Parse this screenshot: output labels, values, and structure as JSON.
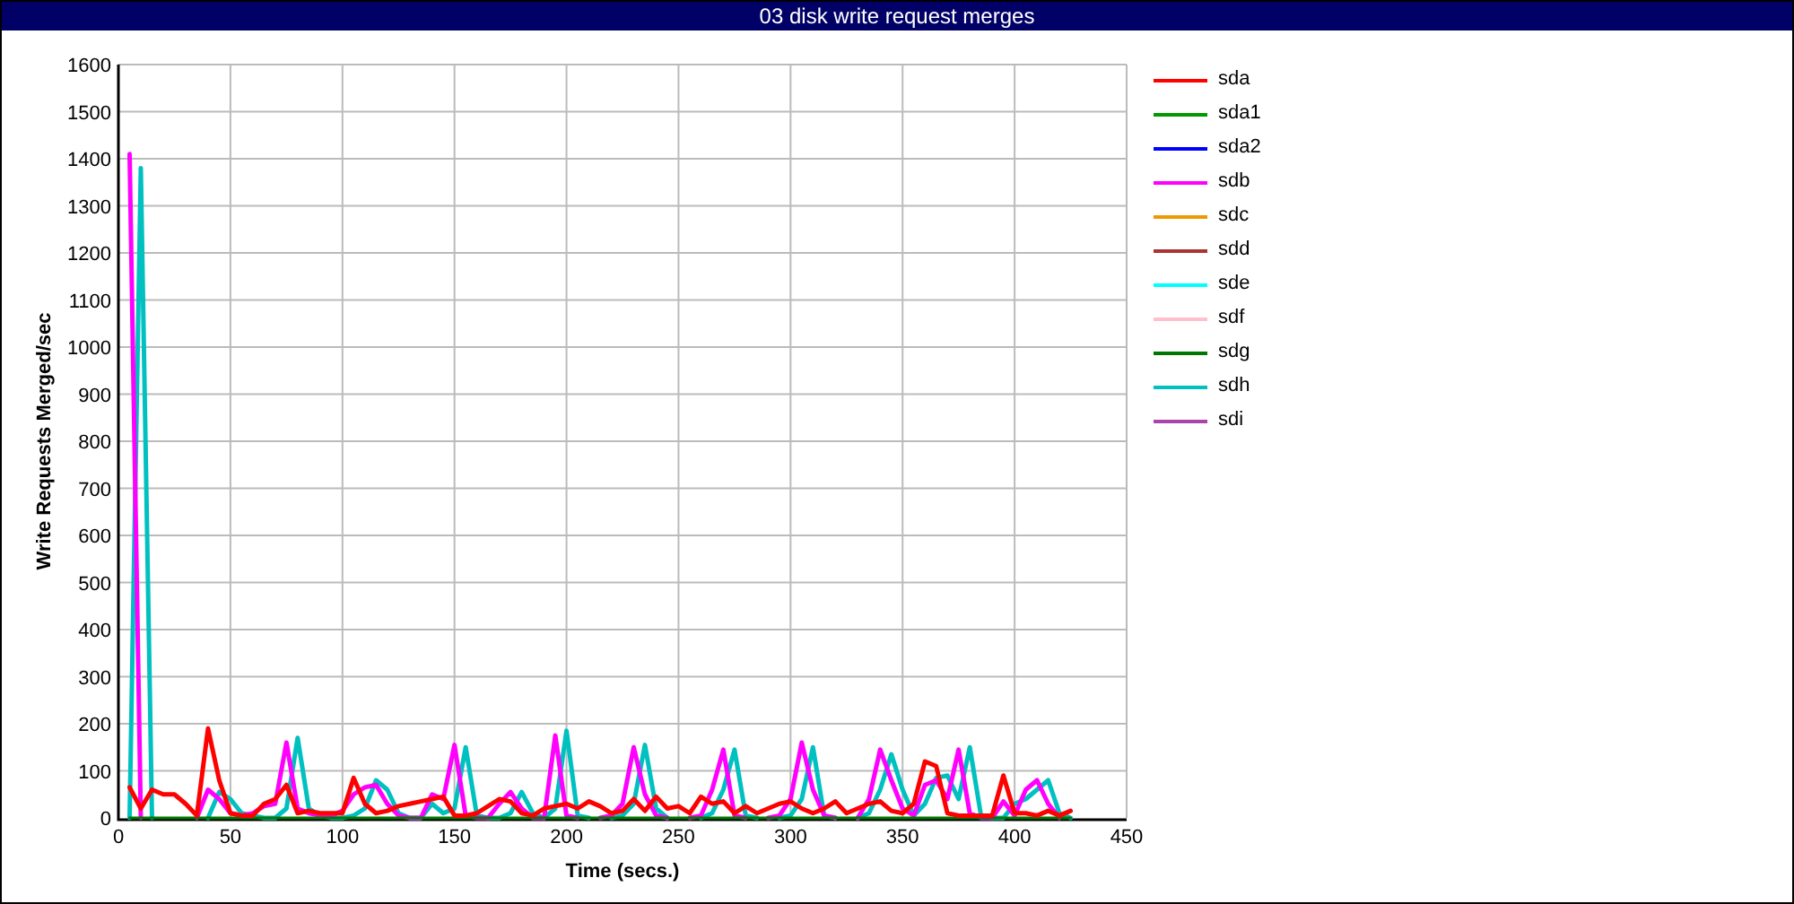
{
  "window": {
    "title": "03 disk write request merges"
  },
  "chart": {
    "chart_data": {
      "type": "line",
      "xlabel": "Time (secs.)",
      "ylabel": "Write Requests Merged/sec",
      "grid": true,
      "xlim": [
        0,
        450
      ],
      "ylim": [
        0,
        1600
      ],
      "xticks": [
        0,
        50,
        100,
        150,
        200,
        250,
        300,
        350,
        400,
        450
      ],
      "yticks": [
        0,
        100,
        200,
        300,
        400,
        500,
        600,
        700,
        800,
        900,
        1000,
        1100,
        1200,
        1300,
        1400,
        1500,
        1600
      ],
      "x": [
        5,
        10,
        15,
        20,
        25,
        30,
        35,
        40,
        45,
        50,
        55,
        60,
        65,
        70,
        75,
        80,
        85,
        90,
        95,
        100,
        105,
        110,
        115,
        120,
        125,
        130,
        135,
        140,
        145,
        150,
        155,
        160,
        165,
        170,
        175,
        180,
        185,
        190,
        195,
        200,
        205,
        210,
        215,
        220,
        225,
        230,
        235,
        240,
        245,
        250,
        255,
        260,
        265,
        270,
        275,
        280,
        285,
        290,
        295,
        300,
        305,
        310,
        315,
        320,
        325,
        330,
        335,
        340,
        345,
        350,
        355,
        360,
        365,
        370,
        375,
        380,
        385,
        390,
        395,
        400,
        405,
        410,
        415,
        420,
        425
      ],
      "series": [
        {
          "name": "sda",
          "color": "#ff0000",
          "values": [
            65,
            20,
            60,
            50,
            50,
            30,
            5,
            190,
            80,
            10,
            5,
            5,
            30,
            40,
            70,
            10,
            15,
            10,
            10,
            10,
            85,
            30,
            10,
            15,
            25,
            30,
            35,
            40,
            45,
            5,
            5,
            10,
            25,
            40,
            35,
            10,
            5,
            20,
            25,
            30,
            20,
            35,
            25,
            10,
            15,
            40,
            15,
            45,
            20,
            25,
            10,
            45,
            30,
            35,
            10,
            25,
            10,
            20,
            30,
            35,
            20,
            10,
            20,
            35,
            10,
            20,
            30,
            35,
            15,
            10,
            30,
            120,
            110,
            10,
            5,
            5,
            5,
            5,
            90,
            10,
            10,
            5,
            15,
            5,
            15
          ]
        },
        {
          "name": "sda1",
          "color": "#009900",
          "values": [
            null,
            null,
            null,
            null,
            null,
            null,
            null,
            null,
            null,
            null,
            null,
            null,
            null,
            null,
            null,
            null,
            null,
            null,
            null,
            null,
            null,
            null,
            null,
            null,
            null,
            null,
            null,
            null,
            null,
            null,
            null,
            null,
            null,
            null,
            null,
            null,
            null,
            null,
            null,
            null,
            null,
            null,
            null,
            null,
            null,
            null,
            null,
            null,
            null,
            null,
            null,
            null,
            null,
            null,
            null,
            null,
            null,
            null,
            null,
            null,
            null,
            null,
            null,
            null,
            null,
            null,
            null,
            null,
            null,
            null,
            null,
            null,
            null,
            null,
            null,
            null,
            null,
            null,
            null,
            null,
            null,
            null,
            null,
            null,
            null
          ]
        },
        {
          "name": "sda2",
          "color": "#0000ff",
          "values": [
            null,
            null,
            null,
            null,
            null,
            null,
            null,
            null,
            null,
            null,
            null,
            null,
            null,
            null,
            null,
            null,
            null,
            null,
            null,
            null,
            null,
            null,
            null,
            null,
            null,
            null,
            null,
            null,
            null,
            null,
            null,
            null,
            null,
            null,
            null,
            null,
            null,
            null,
            null,
            null,
            null,
            null,
            null,
            null,
            null,
            null,
            null,
            null,
            null,
            null,
            null,
            null,
            null,
            null,
            null,
            null,
            null,
            null,
            null,
            null,
            null,
            null,
            null,
            null,
            null,
            null,
            null,
            null,
            null,
            null,
            null,
            null,
            null,
            null,
            null,
            null,
            null,
            null,
            null,
            null,
            null,
            null,
            null,
            null,
            null
          ]
        },
        {
          "name": "sdb",
          "color": "#ff00ff",
          "values": [
            1410,
            0,
            null,
            null,
            null,
            null,
            0,
            60,
            40,
            10,
            5,
            10,
            25,
            30,
            160,
            20,
            10,
            5,
            5,
            15,
            50,
            65,
            70,
            30,
            5,
            0,
            0,
            50,
            40,
            155,
            5,
            0,
            0,
            30,
            55,
            20,
            0,
            0,
            175,
            5,
            0,
            null,
            0,
            5,
            30,
            150,
            50,
            5,
            0,
            null,
            0,
            5,
            60,
            145,
            5,
            0,
            null,
            0,
            5,
            40,
            160,
            60,
            5,
            0,
            null,
            0,
            40,
            145,
            80,
            20,
            5,
            70,
            80,
            40,
            145,
            10,
            0,
            0,
            35,
            5,
            60,
            80,
            30,
            0,
            null
          ]
        },
        {
          "name": "sdc",
          "color": "#ee9900",
          "values": [
            null,
            null,
            null,
            null,
            null,
            null,
            null,
            null,
            null,
            null,
            null,
            null,
            null,
            null,
            null,
            null,
            null,
            null,
            null,
            null,
            null,
            null,
            null,
            null,
            null,
            null,
            null,
            null,
            null,
            null,
            null,
            null,
            null,
            null,
            null,
            null,
            null,
            null,
            null,
            null,
            null,
            null,
            null,
            null,
            null,
            null,
            null,
            null,
            null,
            null,
            null,
            null,
            null,
            null,
            null,
            null,
            null,
            null,
            null,
            null,
            null,
            null,
            null,
            null,
            null,
            null,
            null,
            null,
            null,
            null,
            null,
            null,
            null,
            null,
            null,
            null,
            null,
            null,
            null,
            null,
            null,
            null,
            null,
            null,
            null
          ]
        },
        {
          "name": "sdd",
          "color": "#aa3333",
          "values": [
            null,
            null,
            null,
            null,
            null,
            null,
            null,
            null,
            null,
            null,
            null,
            null,
            null,
            null,
            null,
            null,
            null,
            null,
            null,
            null,
            null,
            null,
            null,
            null,
            null,
            null,
            null,
            null,
            null,
            null,
            null,
            null,
            null,
            null,
            null,
            null,
            null,
            null,
            null,
            null,
            null,
            null,
            null,
            null,
            null,
            null,
            null,
            null,
            null,
            null,
            null,
            null,
            null,
            null,
            null,
            null,
            null,
            null,
            null,
            null,
            null,
            null,
            null,
            null,
            null,
            null,
            null,
            null,
            null,
            null,
            null,
            null,
            null,
            null,
            null,
            null,
            null,
            null,
            null,
            null,
            null,
            null,
            null,
            null,
            null
          ]
        },
        {
          "name": "sde",
          "color": "#00ffff",
          "values": [
            null,
            null,
            null,
            null,
            null,
            null,
            null,
            null,
            null,
            null,
            null,
            null,
            null,
            null,
            null,
            null,
            null,
            null,
            null,
            null,
            null,
            null,
            null,
            null,
            null,
            null,
            null,
            null,
            null,
            null,
            null,
            null,
            null,
            null,
            null,
            null,
            null,
            null,
            null,
            null,
            null,
            null,
            null,
            null,
            null,
            null,
            null,
            null,
            null,
            null,
            null,
            null,
            null,
            null,
            null,
            null,
            null,
            null,
            null,
            null,
            null,
            null,
            null,
            null,
            null,
            null,
            null,
            null,
            null,
            null,
            null,
            null,
            null,
            null,
            null,
            null,
            null,
            null,
            null,
            null,
            null,
            null,
            null,
            null,
            null
          ]
        },
        {
          "name": "sdf",
          "color": "#ffc0cb",
          "values": [
            null,
            null,
            null,
            null,
            null,
            null,
            null,
            null,
            null,
            null,
            null,
            null,
            null,
            null,
            null,
            null,
            null,
            null,
            null,
            null,
            null,
            null,
            null,
            null,
            null,
            null,
            null,
            null,
            null,
            null,
            null,
            null,
            null,
            null,
            null,
            null,
            null,
            null,
            null,
            null,
            null,
            null,
            null,
            null,
            null,
            null,
            null,
            null,
            null,
            null,
            null,
            null,
            null,
            null,
            null,
            null,
            null,
            null,
            null,
            null,
            null,
            null,
            null,
            null,
            null,
            null,
            null,
            null,
            null,
            null,
            null,
            null,
            null,
            null,
            null,
            null,
            null,
            null,
            null,
            null,
            null,
            null,
            null,
            null,
            null
          ]
        },
        {
          "name": "sdg",
          "color": "#007700",
          "values": [
            0,
            0,
            0,
            0,
            0,
            0,
            0,
            0,
            0,
            0,
            0,
            0,
            0,
            0,
            0,
            0,
            0,
            0,
            0,
            0,
            0,
            0,
            0,
            0,
            0,
            0,
            0,
            0,
            0,
            0,
            0,
            0,
            0,
            0,
            0,
            0,
            0,
            0,
            0,
            0,
            0,
            0,
            0,
            0,
            0,
            0,
            0,
            0,
            0,
            0,
            0,
            0,
            0,
            0,
            0,
            0,
            0,
            0,
            0,
            0,
            0,
            0,
            0,
            0,
            0,
            0,
            0,
            0,
            0,
            0,
            0,
            0,
            0,
            0,
            0,
            0,
            0,
            0,
            0,
            0,
            0,
            0,
            0,
            0,
            0
          ]
        },
        {
          "name": "sdh",
          "color": "#00c0c0",
          "values": [
            0,
            1380,
            0,
            null,
            null,
            null,
            null,
            0,
            55,
            40,
            10,
            5,
            0,
            0,
            20,
            170,
            20,
            5,
            0,
            0,
            5,
            20,
            80,
            60,
            10,
            0,
            0,
            30,
            10,
            20,
            150,
            5,
            0,
            0,
            10,
            55,
            10,
            0,
            20,
            185,
            5,
            0,
            null,
            0,
            5,
            30,
            155,
            20,
            0,
            null,
            null,
            0,
            10,
            60,
            145,
            5,
            0,
            null,
            0,
            5,
            40,
            150,
            5,
            0,
            null,
            0,
            10,
            60,
            135,
            60,
            5,
            30,
            85,
            90,
            40,
            150,
            5,
            0,
            0,
            30,
            40,
            60,
            80,
            10,
            0
          ]
        },
        {
          "name": "sdi",
          "color": "#aa44aa",
          "values": [
            null,
            null,
            null,
            null,
            null,
            null,
            null,
            null,
            null,
            null,
            null,
            null,
            null,
            null,
            null,
            null,
            null,
            null,
            null,
            null,
            null,
            null,
            null,
            null,
            null,
            null,
            null,
            null,
            null,
            null,
            null,
            null,
            null,
            null,
            null,
            null,
            null,
            null,
            null,
            null,
            null,
            null,
            null,
            null,
            null,
            null,
            null,
            null,
            null,
            null,
            null,
            null,
            null,
            null,
            null,
            null,
            null,
            null,
            null,
            null,
            null,
            null,
            null,
            null,
            null,
            null,
            null,
            null,
            null,
            null,
            null,
            null,
            null,
            null,
            null,
            null,
            null,
            null,
            null,
            null,
            null,
            null,
            null,
            null,
            null
          ]
        }
      ]
    }
  }
}
